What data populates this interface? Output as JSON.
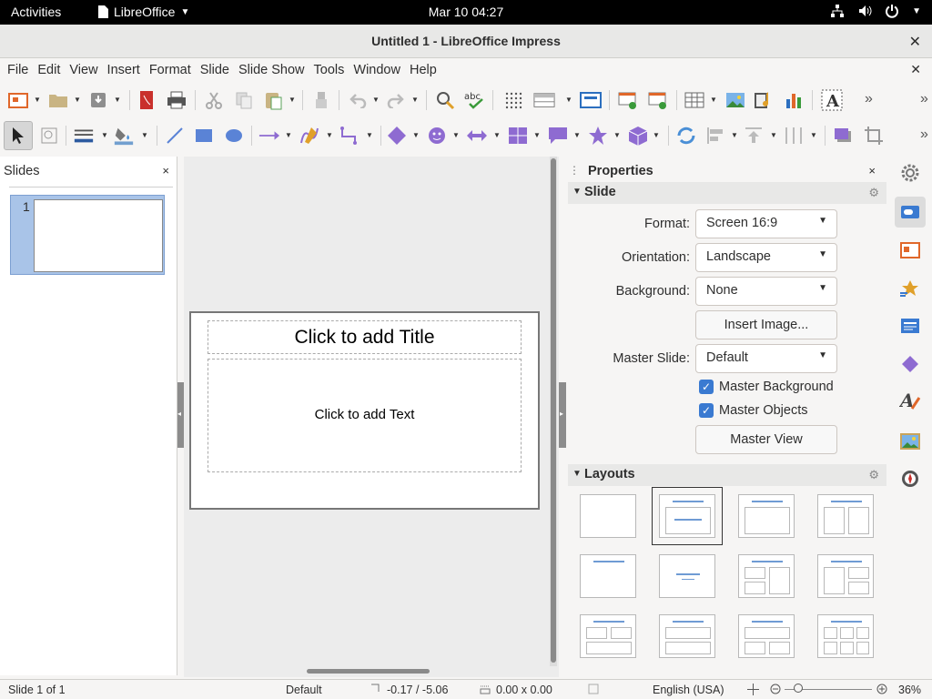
{
  "topbar": {
    "activities": "Activities",
    "app_name": "LibreOffice",
    "clock": "Mar 10  04:27"
  },
  "window": {
    "title": "Untitled 1 - LibreOffice Impress",
    "close": "✕"
  },
  "menu": {
    "items": [
      "File",
      "Edit",
      "View",
      "Insert",
      "Format",
      "Slide",
      "Slide Show",
      "Tools",
      "Window",
      "Help"
    ],
    "doc_close": "✕"
  },
  "slides_pane": {
    "title": "Slides",
    "close": "×",
    "slide_number": "1"
  },
  "slide": {
    "title_placeholder": "Click to add Title",
    "body_placeholder": "Click to add Text"
  },
  "properties": {
    "title": "Properties",
    "close": "×",
    "slide_section": {
      "label": "Slide",
      "format_label": "Format:",
      "format_value": "Screen 16:9",
      "orientation_label": "Orientation:",
      "orientation_value": "Landscape",
      "background_label": "Background:",
      "background_value": "None",
      "insert_image": "Insert Image...",
      "master_slide_label": "Master Slide:",
      "master_slide_value": "Default",
      "master_background": "Master Background",
      "master_background_checked": true,
      "master_objects": "Master Objects",
      "master_objects_checked": true,
      "master_view": "Master View"
    },
    "layouts_section": {
      "label": "Layouts",
      "selected_index": 1
    }
  },
  "statusbar": {
    "slide_info": "Slide 1 of 1",
    "master": "Default",
    "position": "-0.17 / -5.06",
    "size": "0.00 x 0.00",
    "language": "English (USA)",
    "zoom": "36%"
  },
  "colors": {
    "accent": "#3a7ad1",
    "shape_fill": "#8e6bd1",
    "selection": "#a9c4e8"
  }
}
